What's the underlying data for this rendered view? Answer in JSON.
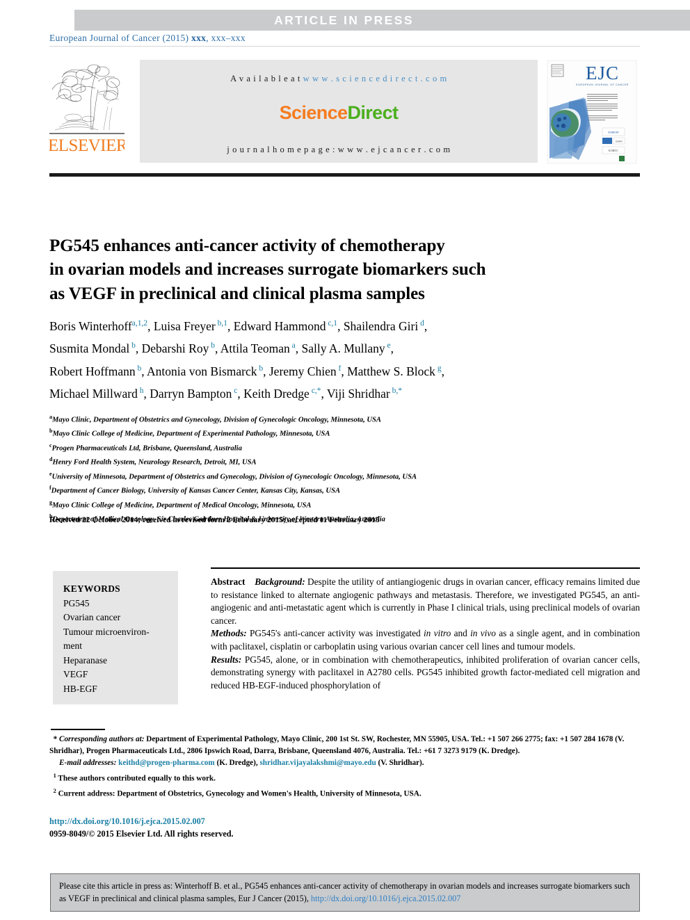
{
  "banner": {
    "text": "ARTICLE  IN  PRESS"
  },
  "journal_line": {
    "prefix": "European Journal of Cancer (2015) ",
    "volume": "xxx",
    "pages": ", xxx–xxx"
  },
  "masthead": {
    "publisher_logo": "elsevier-tree-logo",
    "publisher_name": "ELSEVIER",
    "available_label": "A v a i l a b l e   a t  ",
    "available_url": "w w w . s c i e n c e d i r e c t . c o m",
    "sciencedirect_part1": "Science",
    "sciencedirect_part2": "Direct",
    "homepage": "j o u r n a l   h o m e p a g e :   w w w . e j c a n c e r . c o m",
    "cover_alt": "EJC European Journal of Cancer cover thumbnail"
  },
  "article": {
    "title_lines": [
      "PG545 enhances anti-cancer activity of chemotherapy",
      "in ovarian models and increases surrogate biomarkers such",
      "as VEGF in preclinical and clinical plasma samples"
    ],
    "received": "Received 22 October 2014; received in revised form 2 February 2015; accepted 11 February 2015"
  },
  "authors": {
    "lines": [
      [
        {
          "name": "Boris Winterhoff",
          "sup": "a,1,2",
          "sep": ", "
        },
        {
          "name": "Luisa Freyer",
          "sup": " b,1",
          "sep": ", "
        },
        {
          "name": "Edward Hammond",
          "sup": " c,1",
          "sep": ", "
        },
        {
          "name": "Shailendra Giri",
          "sup": " d",
          "sep": ","
        }
      ],
      [
        {
          "name": "Susmita Mondal",
          "sup": " b",
          "sep": ", "
        },
        {
          "name": "Debarshi Roy",
          "sup": " b",
          "sep": ", "
        },
        {
          "name": "Attila Teoman",
          "sup": " a",
          "sep": ", "
        },
        {
          "name": "Sally A. Mullany",
          "sup": " e",
          "sep": ","
        }
      ],
      [
        {
          "name": "Robert Hoffmann",
          "sup": " b",
          "sep": ", "
        },
        {
          "name": "Antonia von Bismarck",
          "sup": " b",
          "sep": ", "
        },
        {
          "name": "Jeremy Chien",
          "sup": " f",
          "sep": ", "
        },
        {
          "name": "Matthew S. Block",
          "sup": " g",
          "sep": ","
        }
      ],
      [
        {
          "name": "Michael Millward",
          "sup": " h",
          "sep": ", "
        },
        {
          "name": "Darryn Bampton",
          "sup": " c",
          "sep": ", "
        },
        {
          "name": "Keith Dredge",
          "sup": " c,*",
          "sep": ", "
        },
        {
          "name": "Viji Shridhar",
          "sup": " b,*",
          "sep": ""
        }
      ]
    ]
  },
  "affiliations": [
    {
      "mark": "a",
      "text": "Mayo Clinic, Department of Obstetrics and Gynecology, Division of Gynecologic Oncology, Minnesota, USA"
    },
    {
      "mark": "b",
      "text": "Mayo Clinic College of Medicine, Department of Experimental Pathology, Minnesota, USA"
    },
    {
      "mark": "c",
      "text": "Progen Pharmaceuticals Ltd, Brisbane, Queensland, Australia"
    },
    {
      "mark": "d",
      "text": "Henry Ford Health System, Neurology Research, Detroit, MI, USA"
    },
    {
      "mark": "e",
      "text": "University of Minnesota, Department of Obstetrics and Gynecology, Division of Gynecologic Oncology, Minnesota, USA"
    },
    {
      "mark": "f",
      "text": "Department of Cancer Biology, University of Kansas Cancer Center, Kansas City, Kansas, USA"
    },
    {
      "mark": "g",
      "text": "Mayo Clinic College of Medicine, Department of Medical Oncology, Minnesota, USA"
    },
    {
      "mark": "h",
      "text": "Department of Medical Oncology, Sir Charles Gairdner Hospital & University of Western Australia, Australia"
    }
  ],
  "keywords": {
    "heading": "KEYWORDS",
    "items": [
      "PG545",
      "Ovarian cancer",
      "Tumour microenviron-",
      "ment",
      "Heparanase",
      "VEGF",
      "HB-EGF"
    ]
  },
  "abstract": {
    "label": "Abstract",
    "background_label": "Background:",
    "background_text": " Despite the utility of antiangiogenic drugs in ovarian cancer, efficacy remains limited due to resistance linked to alternate angiogenic pathways and metastasis. Therefore, we investigated PG545, an anti-angiogenic and anti-metastatic agent which is currently in Phase I clinical trials, using preclinical models of ovarian cancer.",
    "methods_label": "Methods:",
    "methods_pre": " PG545's anti-cancer activity was investigated ",
    "methods_i1": "in vitro",
    "methods_mid": " and ",
    "methods_i2": "in vivo",
    "methods_post": " as a single agent, and in combination with paclitaxel, cisplatin or carboplatin using various ovarian cancer cell lines and tumour models.",
    "results_label": "Results:",
    "results_text": " PG545, alone, or in combination with chemotherapeutics, inhibited proliferation of ovarian cancer cells, demonstrating synergy with paclitaxel in A2780 cells. PG545 inhibited growth factor-mediated cell migration and reduced HB-EGF-induced phosphorylation of"
  },
  "footnotes": {
    "star_mark": "*",
    "corresponding_label": "Corresponding authors at:",
    "corresponding_text": " Department of Experimental Pathology, Mayo Clinic, 200 1st St. SW, Rochester, MN 55905, USA. Tel.: +1 507 266 2775; fax: +1 507 284 1678 (V. Shridhar), Progen Pharmaceuticals Ltd., 2806 Ipswich Road, Darra, Brisbane, Queensland 4076, Australia. Tel.: +61 7 3273 9179 (K. Dredge).",
    "email_label": "E-mail addresses:",
    "email_1": "keithd@progen-pharma.com",
    "email_1_who": " (K. Dredge), ",
    "email_2": "shridhar.vijayalakshmi@mayo.edu",
    "email_2_who": " (V. Shridhar).",
    "note_1_mark": "1",
    "note_1": " These authors contributed equally to this work.",
    "note_2_mark": "2",
    "note_2": " Current address: Department of Obstetrics, Gynecology and Women's Health, University of Minnesota, USA."
  },
  "doi_block": {
    "doi": "http://dx.doi.org/10.1016/j.ejca.2015.02.007",
    "copyright": "0959-8049/© 2015 Elsevier Ltd. All rights reserved."
  },
  "citation": {
    "text": "Please cite this article in press as: Winterhoff B. et al., PG545 enhances anti-cancer activity of chemotherapy in ovarian models and increases surrogate biomarkers such as VEGF in preclinical and clinical plasma samples, Eur J Cancer (2015), ",
    "link": "http://dx.doi.org/10.1016/j.ejca.2015.02.007"
  },
  "colors": {
    "banner_gray": "#c9cbcd",
    "link_blue": "#1b7fa5",
    "journal_blue": "#2f6fa8",
    "elsevier_orange": "#ef7d22",
    "sciencedirect_orange": "#f57c20",
    "sciencedirect_green": "#4caf1f",
    "keyword_box_gray": "#e6e6e6"
  }
}
